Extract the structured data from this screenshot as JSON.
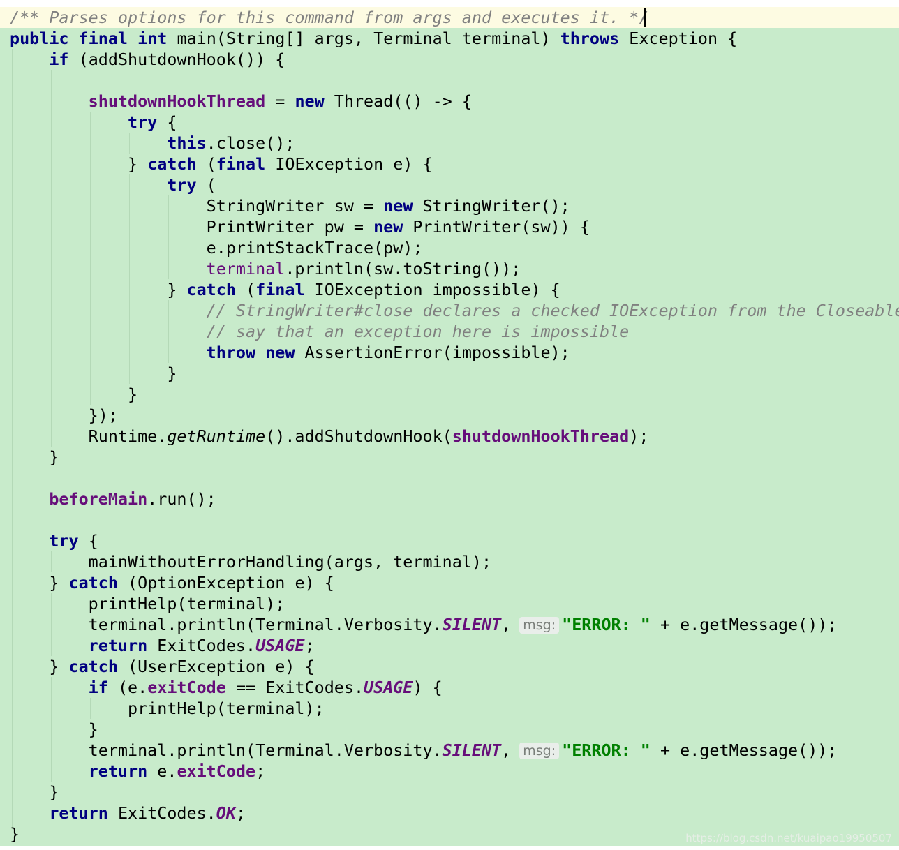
{
  "editor": {
    "background": "#c8ebcb",
    "doc_comment_background": "#fdfbe2",
    "code": {
      "l1": "/** Parses options for this command from args and executes it. */",
      "l2": {
        "a": "public",
        "b": "final",
        "c": "int",
        "d": "main(String[] args, Terminal terminal)",
        "e": "throws",
        "f": "Exception {"
      },
      "l3": {
        "a": "if",
        "b": "(addShutdownHook()) {"
      },
      "l5": {
        "a": "shutdownHookThread",
        "b": "=",
        "c": "new",
        "d": "Thread(() -> {"
      },
      "l6": {
        "a": "try",
        "b": "{"
      },
      "l7": {
        "a": "this",
        "b": ".close();"
      },
      "l8": {
        "a": "}",
        "b": "catch",
        "c": "(",
        "d": "final",
        "e": "IOException e) {"
      },
      "l9": {
        "a": "try",
        "b": "("
      },
      "l10": {
        "a": "StringWriter sw =",
        "b": "new",
        "c": "StringWriter();"
      },
      "l11": {
        "a": "PrintWriter pw =",
        "b": "new",
        "c": "PrintWriter(sw)) {"
      },
      "l12": "e.printStackTrace(pw);",
      "l13": {
        "a": "terminal",
        "b": ".println(sw.toString());"
      },
      "l14": {
        "a": "}",
        "b": "catch",
        "c": "(",
        "d": "final",
        "e": "IOException impossible) {"
      },
      "l15": "// StringWriter#close declares a checked IOException from the Closeable",
      "l16": "// say that an exception here is impossible",
      "l17": {
        "a": "throw",
        "b": "new",
        "c": "AssertionError(impossible);"
      },
      "l18": "}",
      "l19": "}",
      "l20": "});",
      "l21": {
        "a": "Runtime.",
        "b": "getRuntime",
        "c": "().addShutdownHook(",
        "d": "shutdownHookThread",
        "e": ");"
      },
      "l22": "}",
      "l24": {
        "a": "beforeMain",
        "b": ".run();"
      },
      "l26": {
        "a": "try",
        "b": "{"
      },
      "l27": "mainWithoutErrorHandling(args, terminal);",
      "l28": {
        "a": "}",
        "b": "catch",
        "c": "(OptionException e) {"
      },
      "l29": "printHelp(terminal);",
      "l30": {
        "a": "terminal.println(Terminal.Verbosity.",
        "b": "SILENT",
        "c": ",",
        "hint": "msg:",
        "d": "\"ERROR: \"",
        "e": "+ e.getMessage());"
      },
      "l31": {
        "a": "return",
        "b": "ExitCodes.",
        "c": "USAGE",
        "d": ";"
      },
      "l32": {
        "a": "}",
        "b": "catch",
        "c": "(UserException e) {"
      },
      "l33": {
        "a": "if",
        "b": "(e.",
        "c": "exitCode",
        "d": "== ExitCodes.",
        "e": "USAGE",
        "f": ") {"
      },
      "l34": "printHelp(terminal);",
      "l35": "}",
      "l36": {
        "a": "terminal.println(Terminal.Verbosity.",
        "b": "SILENT",
        "c": ",",
        "hint": "msg:",
        "d": "\"ERROR: \"",
        "e": "+ e.getMessage());"
      },
      "l37": {
        "a": "return",
        "b": "e.",
        "c": "exitCode",
        "d": ";"
      },
      "l38": "}",
      "l39": {
        "a": "return",
        "b": "ExitCodes.",
        "c": "OK",
        "d": ";"
      },
      "l40": "}"
    }
  },
  "watermark": "https://blog.csdn.net/kuaipao19950507"
}
